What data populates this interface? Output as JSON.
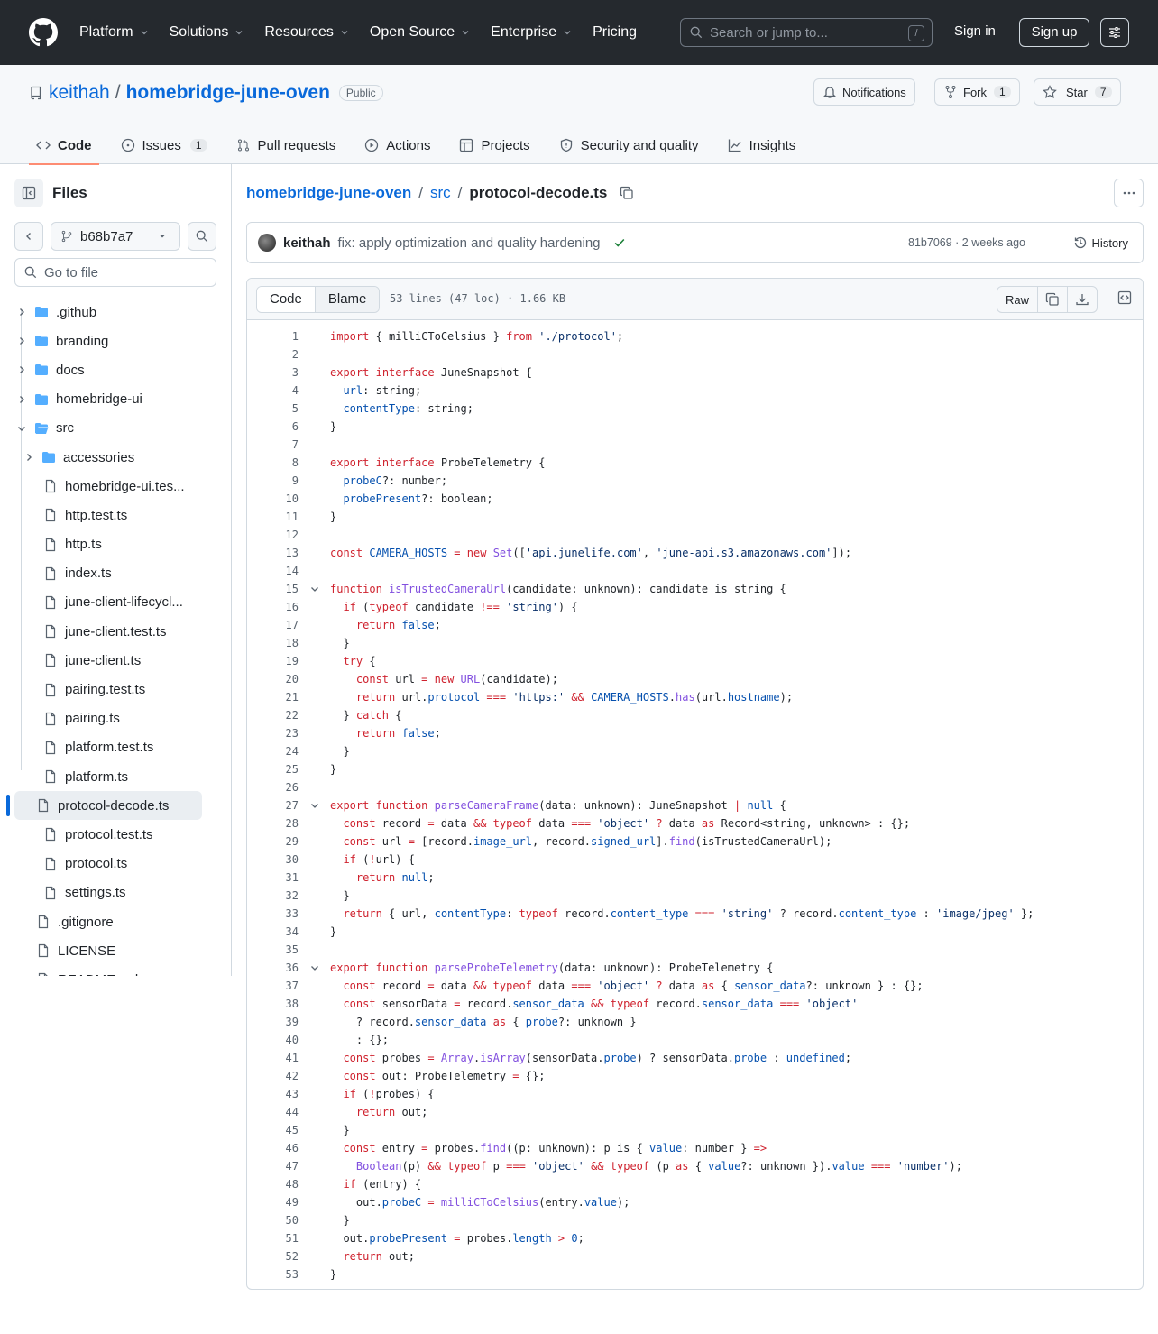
{
  "header": {
    "nav": [
      "Platform",
      "Solutions",
      "Resources",
      "Open Source",
      "Enterprise",
      "Pricing"
    ],
    "search_placeholder": "Search or jump to...",
    "search_shortcut": "/",
    "sign_in": "Sign in",
    "sign_up": "Sign up"
  },
  "repo": {
    "owner": "keithah",
    "separator": "/",
    "name": "homebridge-june-oven",
    "visibility": "Public",
    "notifications": "Notifications",
    "fork_label": "Fork",
    "fork_count": "1",
    "star_label": "Star",
    "star_count": "7",
    "tabs": [
      {
        "label": "Code",
        "icon": "code-icon"
      },
      {
        "label": "Issues",
        "icon": "issue-icon",
        "count": "1"
      },
      {
        "label": "Pull requests",
        "icon": "pull-request-icon"
      },
      {
        "label": "Actions",
        "icon": "play-icon"
      },
      {
        "label": "Projects",
        "icon": "table-icon"
      },
      {
        "label": "Security and quality",
        "icon": "shield-icon"
      },
      {
        "label": "Insights",
        "icon": "graph-icon"
      }
    ]
  },
  "sidebar": {
    "title": "Files",
    "branch": "b68b7a7",
    "goto_placeholder": "Go to file",
    "tree": [
      {
        "name": ".github",
        "type": "dir",
        "depth": 0,
        "open": false
      },
      {
        "name": "branding",
        "type": "dir",
        "depth": 0,
        "open": false
      },
      {
        "name": "docs",
        "type": "dir",
        "depth": 0,
        "open": false
      },
      {
        "name": "homebridge-ui",
        "type": "dir",
        "depth": 0,
        "open": false
      },
      {
        "name": "src",
        "type": "dir",
        "depth": 0,
        "open": true
      },
      {
        "name": "accessories",
        "type": "dir",
        "depth": 1,
        "open": false
      },
      {
        "name": "homebridge-ui.tes...",
        "type": "file",
        "depth": 1
      },
      {
        "name": "http.test.ts",
        "type": "file",
        "depth": 1
      },
      {
        "name": "http.ts",
        "type": "file",
        "depth": 1
      },
      {
        "name": "index.ts",
        "type": "file",
        "depth": 1
      },
      {
        "name": "june-client-lifecycl...",
        "type": "file",
        "depth": 1
      },
      {
        "name": "june-client.test.ts",
        "type": "file",
        "depth": 1
      },
      {
        "name": "june-client.ts",
        "type": "file",
        "depth": 1
      },
      {
        "name": "pairing.test.ts",
        "type": "file",
        "depth": 1
      },
      {
        "name": "pairing.ts",
        "type": "file",
        "depth": 1
      },
      {
        "name": "platform.test.ts",
        "type": "file",
        "depth": 1
      },
      {
        "name": "platform.ts",
        "type": "file",
        "depth": 1
      },
      {
        "name": "protocol-decode.ts",
        "type": "file",
        "depth": 1,
        "selected": true
      },
      {
        "name": "protocol.test.ts",
        "type": "file",
        "depth": 1
      },
      {
        "name": "protocol.ts",
        "type": "file",
        "depth": 1
      },
      {
        "name": "settings.ts",
        "type": "file",
        "depth": 1
      },
      {
        "name": ".gitignore",
        "type": "file",
        "depth": 0
      },
      {
        "name": "LICENSE",
        "type": "file",
        "depth": 0
      },
      {
        "name": "README.md",
        "type": "file",
        "depth": 0
      }
    ]
  },
  "breadcrumb": {
    "repo": "homebridge-june-oven",
    "dir": "src",
    "sep": "/",
    "file": "protocol-decode.ts"
  },
  "commit": {
    "author": "keithah",
    "message": "fix: apply optimization and quality hardening",
    "meta": "81b7069 · 2 weeks ago",
    "history": "History"
  },
  "file": {
    "tab_code": "Code",
    "tab_blame": "Blame",
    "info": "53 lines (47 loc) · 1.66 KB",
    "raw": "Raw"
  },
  "code_lines": [
    [
      [
        "k",
        "import"
      ],
      [
        "t",
        " { milliCToCelsius } "
      ],
      [
        "k",
        "from"
      ],
      [
        "t",
        " "
      ],
      [
        "s",
        "'./protocol'"
      ],
      [
        "t",
        ";"
      ]
    ],
    [],
    [
      [
        "k",
        "export"
      ],
      [
        "t",
        " "
      ],
      [
        "k",
        "interface"
      ],
      [
        "t",
        " JuneSnapshot {"
      ]
    ],
    [
      [
        "t",
        "  "
      ],
      [
        "p",
        "url"
      ],
      [
        "t",
        ": string;"
      ]
    ],
    [
      [
        "t",
        "  "
      ],
      [
        "p",
        "contentType"
      ],
      [
        "t",
        ": string;"
      ]
    ],
    [
      [
        "t",
        "}"
      ]
    ],
    [],
    [
      [
        "k",
        "export"
      ],
      [
        "t",
        " "
      ],
      [
        "k",
        "interface"
      ],
      [
        "t",
        " ProbeTelemetry {"
      ]
    ],
    [
      [
        "t",
        "  "
      ],
      [
        "p",
        "probeC"
      ],
      [
        "t",
        "?: number;"
      ]
    ],
    [
      [
        "t",
        "  "
      ],
      [
        "p",
        "probePresent"
      ],
      [
        "t",
        "?: boolean;"
      ]
    ],
    [
      [
        "t",
        "}"
      ]
    ],
    [],
    [
      [
        "k",
        "const"
      ],
      [
        "t",
        " "
      ],
      [
        "p",
        "CAMERA_HOSTS"
      ],
      [
        "t",
        " "
      ],
      [
        "k",
        "="
      ],
      [
        "t",
        " "
      ],
      [
        "k",
        "new"
      ],
      [
        "t",
        " "
      ],
      [
        "f",
        "Set"
      ],
      [
        "t",
        "(["
      ],
      [
        "s",
        "'api.junelife.com'"
      ],
      [
        "t",
        ", "
      ],
      [
        "s",
        "'june-api.s3.amazonaws.com'"
      ],
      [
        "t",
        "]);"
      ]
    ],
    [],
    [
      [
        "k",
        "function"
      ],
      [
        "t",
        " "
      ],
      [
        "f",
        "isTrustedCameraUrl"
      ],
      [
        "t",
        "(candidate: unknown): candidate is string {"
      ]
    ],
    [
      [
        "t",
        "  "
      ],
      [
        "k",
        "if"
      ],
      [
        "t",
        " ("
      ],
      [
        "k",
        "typeof"
      ],
      [
        "t",
        " candidate "
      ],
      [
        "k",
        "!=="
      ],
      [
        "t",
        " "
      ],
      [
        "s",
        "'string'"
      ],
      [
        "t",
        ") {"
      ]
    ],
    [
      [
        "t",
        "    "
      ],
      [
        "k",
        "return"
      ],
      [
        "t",
        " "
      ],
      [
        "p",
        "false"
      ],
      [
        "t",
        ";"
      ]
    ],
    [
      [
        "t",
        "  }"
      ]
    ],
    [
      [
        "t",
        "  "
      ],
      [
        "k",
        "try"
      ],
      [
        "t",
        " {"
      ]
    ],
    [
      [
        "t",
        "    "
      ],
      [
        "k",
        "const"
      ],
      [
        "t",
        " url "
      ],
      [
        "k",
        "="
      ],
      [
        "t",
        " "
      ],
      [
        "k",
        "new"
      ],
      [
        "t",
        " "
      ],
      [
        "f",
        "URL"
      ],
      [
        "t",
        "(candidate);"
      ]
    ],
    [
      [
        "t",
        "    "
      ],
      [
        "k",
        "return"
      ],
      [
        "t",
        " url."
      ],
      [
        "p",
        "protocol"
      ],
      [
        "t",
        " "
      ],
      [
        "k",
        "==="
      ],
      [
        "t",
        " "
      ],
      [
        "s",
        "'https:'"
      ],
      [
        "t",
        " "
      ],
      [
        "k",
        "&&"
      ],
      [
        "t",
        " "
      ],
      [
        "p",
        "CAMERA_HOSTS"
      ],
      [
        "t",
        "."
      ],
      [
        "f",
        "has"
      ],
      [
        "t",
        "(url."
      ],
      [
        "p",
        "hostname"
      ],
      [
        "t",
        ");"
      ]
    ],
    [
      [
        "t",
        "  } "
      ],
      [
        "k",
        "catch"
      ],
      [
        "t",
        " {"
      ]
    ],
    [
      [
        "t",
        "    "
      ],
      [
        "k",
        "return"
      ],
      [
        "t",
        " "
      ],
      [
        "p",
        "false"
      ],
      [
        "t",
        ";"
      ]
    ],
    [
      [
        "t",
        "  }"
      ]
    ],
    [
      [
        "t",
        "}"
      ]
    ],
    [],
    [
      [
        "k",
        "export"
      ],
      [
        "t",
        " "
      ],
      [
        "k",
        "function"
      ],
      [
        "t",
        " "
      ],
      [
        "f",
        "parseCameraFrame"
      ],
      [
        "t",
        "(data: unknown): JuneSnapshot "
      ],
      [
        "k",
        "|"
      ],
      [
        "t",
        " "
      ],
      [
        "p",
        "null"
      ],
      [
        "t",
        " {"
      ]
    ],
    [
      [
        "t",
        "  "
      ],
      [
        "k",
        "const"
      ],
      [
        "t",
        " record "
      ],
      [
        "k",
        "="
      ],
      [
        "t",
        " data "
      ],
      [
        "k",
        "&&"
      ],
      [
        "t",
        " "
      ],
      [
        "k",
        "typeof"
      ],
      [
        "t",
        " data "
      ],
      [
        "k",
        "==="
      ],
      [
        "t",
        " "
      ],
      [
        "s",
        "'object'"
      ],
      [
        "t",
        " "
      ],
      [
        "k",
        "?"
      ],
      [
        "t",
        " data "
      ],
      [
        "k",
        "as"
      ],
      [
        "t",
        " Record<string, unknown> : {};"
      ]
    ],
    [
      [
        "t",
        "  "
      ],
      [
        "k",
        "const"
      ],
      [
        "t",
        " url "
      ],
      [
        "k",
        "="
      ],
      [
        "t",
        " [record."
      ],
      [
        "p",
        "image_url"
      ],
      [
        "t",
        ", record."
      ],
      [
        "p",
        "signed_url"
      ],
      [
        "t",
        "]."
      ],
      [
        "f",
        "find"
      ],
      [
        "t",
        "(isTrustedCameraUrl);"
      ]
    ],
    [
      [
        "t",
        "  "
      ],
      [
        "k",
        "if"
      ],
      [
        "t",
        " ("
      ],
      [
        "k",
        "!"
      ],
      [
        "t",
        "url) {"
      ]
    ],
    [
      [
        "t",
        "    "
      ],
      [
        "k",
        "return"
      ],
      [
        "t",
        " "
      ],
      [
        "p",
        "null"
      ],
      [
        "t",
        ";"
      ]
    ],
    [
      [
        "t",
        "  }"
      ]
    ],
    [
      [
        "t",
        "  "
      ],
      [
        "k",
        "return"
      ],
      [
        "t",
        " { url, "
      ],
      [
        "p",
        "contentType"
      ],
      [
        "t",
        ": "
      ],
      [
        "k",
        "typeof"
      ],
      [
        "t",
        " record."
      ],
      [
        "p",
        "content_type"
      ],
      [
        "t",
        " "
      ],
      [
        "k",
        "==="
      ],
      [
        "t",
        " "
      ],
      [
        "s",
        "'string'"
      ],
      [
        "t",
        " ? record."
      ],
      [
        "p",
        "content_type"
      ],
      [
        "t",
        " : "
      ],
      [
        "s",
        "'image/jpeg'"
      ],
      [
        "t",
        " };"
      ]
    ],
    [
      [
        "t",
        "}"
      ]
    ],
    [],
    [
      [
        "k",
        "export"
      ],
      [
        "t",
        " "
      ],
      [
        "k",
        "function"
      ],
      [
        "t",
        " "
      ],
      [
        "f",
        "parseProbeTelemetry"
      ],
      [
        "t",
        "(data: unknown): ProbeTelemetry {"
      ]
    ],
    [
      [
        "t",
        "  "
      ],
      [
        "k",
        "const"
      ],
      [
        "t",
        " record "
      ],
      [
        "k",
        "="
      ],
      [
        "t",
        " data "
      ],
      [
        "k",
        "&&"
      ],
      [
        "t",
        " "
      ],
      [
        "k",
        "typeof"
      ],
      [
        "t",
        " data "
      ],
      [
        "k",
        "==="
      ],
      [
        "t",
        " "
      ],
      [
        "s",
        "'object'"
      ],
      [
        "t",
        " "
      ],
      [
        "k",
        "?"
      ],
      [
        "t",
        " data "
      ],
      [
        "k",
        "as"
      ],
      [
        "t",
        " { "
      ],
      [
        "p",
        "sensor_data"
      ],
      [
        "t",
        "?: unknown } : {};"
      ]
    ],
    [
      [
        "t",
        "  "
      ],
      [
        "k",
        "const"
      ],
      [
        "t",
        " sensorData "
      ],
      [
        "k",
        "="
      ],
      [
        "t",
        " record."
      ],
      [
        "p",
        "sensor_data"
      ],
      [
        "t",
        " "
      ],
      [
        "k",
        "&&"
      ],
      [
        "t",
        " "
      ],
      [
        "k",
        "typeof"
      ],
      [
        "t",
        " record."
      ],
      [
        "p",
        "sensor_data"
      ],
      [
        "t",
        " "
      ],
      [
        "k",
        "==="
      ],
      [
        "t",
        " "
      ],
      [
        "s",
        "'object'"
      ]
    ],
    [
      [
        "t",
        "    ? record."
      ],
      [
        "p",
        "sensor_data"
      ],
      [
        "t",
        " "
      ],
      [
        "k",
        "as"
      ],
      [
        "t",
        " { "
      ],
      [
        "p",
        "probe"
      ],
      [
        "t",
        "?: unknown }"
      ]
    ],
    [
      [
        "t",
        "    : {};"
      ]
    ],
    [
      [
        "t",
        "  "
      ],
      [
        "k",
        "const"
      ],
      [
        "t",
        " probes "
      ],
      [
        "k",
        "="
      ],
      [
        "t",
        " "
      ],
      [
        "f",
        "Array"
      ],
      [
        "t",
        "."
      ],
      [
        "f",
        "isArray"
      ],
      [
        "t",
        "(sensorData."
      ],
      [
        "p",
        "probe"
      ],
      [
        "t",
        ") ? sensorData."
      ],
      [
        "p",
        "probe"
      ],
      [
        "t",
        " : "
      ],
      [
        "p",
        "undefined"
      ],
      [
        "t",
        ";"
      ]
    ],
    [
      [
        "t",
        "  "
      ],
      [
        "k",
        "const"
      ],
      [
        "t",
        " out: ProbeTelemetry "
      ],
      [
        "k",
        "="
      ],
      [
        "t",
        " {};"
      ]
    ],
    [
      [
        "t",
        "  "
      ],
      [
        "k",
        "if"
      ],
      [
        "t",
        " ("
      ],
      [
        "k",
        "!"
      ],
      [
        "t",
        "probes) {"
      ]
    ],
    [
      [
        "t",
        "    "
      ],
      [
        "k",
        "return"
      ],
      [
        "t",
        " out;"
      ]
    ],
    [
      [
        "t",
        "  }"
      ]
    ],
    [
      [
        "t",
        "  "
      ],
      [
        "k",
        "const"
      ],
      [
        "t",
        " entry "
      ],
      [
        "k",
        "="
      ],
      [
        "t",
        " probes."
      ],
      [
        "f",
        "find"
      ],
      [
        "t",
        "((p: unknown): p is { "
      ],
      [
        "p",
        "value"
      ],
      [
        "t",
        ": number } "
      ],
      [
        "k",
        "=>"
      ]
    ],
    [
      [
        "t",
        "    "
      ],
      [
        "f",
        "Boolean"
      ],
      [
        "t",
        "(p) "
      ],
      [
        "k",
        "&&"
      ],
      [
        "t",
        " "
      ],
      [
        "k",
        "typeof"
      ],
      [
        "t",
        " p "
      ],
      [
        "k",
        "==="
      ],
      [
        "t",
        " "
      ],
      [
        "s",
        "'object'"
      ],
      [
        "t",
        " "
      ],
      [
        "k",
        "&&"
      ],
      [
        "t",
        " "
      ],
      [
        "k",
        "typeof"
      ],
      [
        "t",
        " (p "
      ],
      [
        "k",
        "as"
      ],
      [
        "t",
        " { "
      ],
      [
        "p",
        "value"
      ],
      [
        "t",
        "?: unknown })."
      ],
      [
        "p",
        "value"
      ],
      [
        "t",
        " "
      ],
      [
        "k",
        "==="
      ],
      [
        "t",
        " "
      ],
      [
        "s",
        "'number'"
      ],
      [
        "t",
        ");"
      ]
    ],
    [
      [
        "t",
        "  "
      ],
      [
        "k",
        "if"
      ],
      [
        "t",
        " (entry) {"
      ]
    ],
    [
      [
        "t",
        "    out."
      ],
      [
        "p",
        "probeC"
      ],
      [
        "t",
        " "
      ],
      [
        "k",
        "="
      ],
      [
        "t",
        " "
      ],
      [
        "f",
        "milliCToCelsius"
      ],
      [
        "t",
        "(entry."
      ],
      [
        "p",
        "value"
      ],
      [
        "t",
        ");"
      ]
    ],
    [
      [
        "t",
        "  }"
      ]
    ],
    [
      [
        "t",
        "  out."
      ],
      [
        "p",
        "probePresent"
      ],
      [
        "t",
        " "
      ],
      [
        "k",
        "="
      ],
      [
        "t",
        " probes."
      ],
      [
        "p",
        "length"
      ],
      [
        "t",
        " "
      ],
      [
        "k",
        ">"
      ],
      [
        "t",
        " "
      ],
      [
        "p",
        "0"
      ],
      [
        "t",
        ";"
      ]
    ],
    [
      [
        "t",
        "  "
      ],
      [
        "k",
        "return"
      ],
      [
        "t",
        " out;"
      ]
    ],
    [
      [
        "t",
        "}"
      ]
    ]
  ],
  "fold_lines": [
    15,
    27,
    36
  ]
}
